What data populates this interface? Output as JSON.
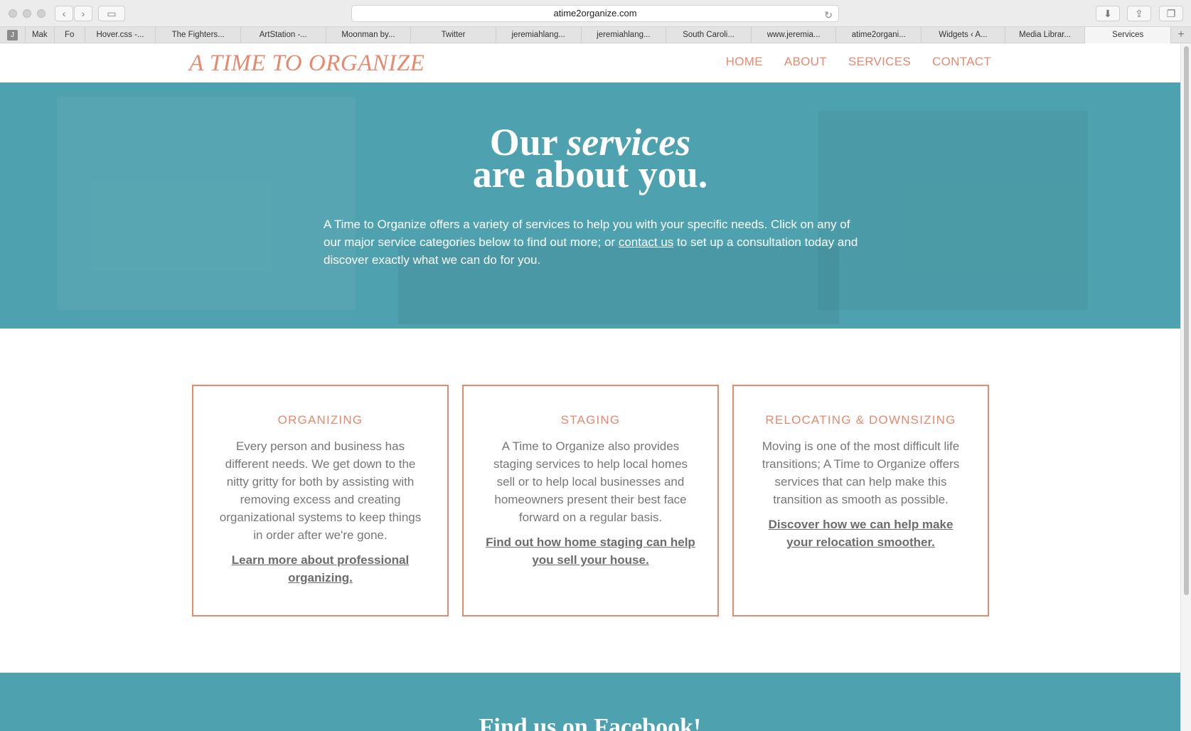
{
  "browser": {
    "url": "atime2organize.com",
    "favicon_letter": "J",
    "tabs": [
      "Mak",
      "Fo",
      "Hover.css -...",
      "The Fighters...",
      "ArtStation -...",
      "Moonman by...",
      "Twitter",
      "jeremiahlang...",
      "jeremiahlang...",
      "South Caroli...",
      "www.jeremia...",
      "atime2organi...",
      "Widgets ‹ A...",
      "Media Librar...",
      "Services"
    ],
    "active_tab": "Services"
  },
  "site": {
    "logo": "A TIME TO ORGANIZE",
    "nav": [
      "HOME",
      "ABOUT",
      "SERVICES",
      "CONTACT"
    ]
  },
  "hero": {
    "title_our": "Our",
    "title_services": "services",
    "title_line2": "are about you.",
    "intro_before": "A Time to Organize offers a variety of services to help you with your specific needs. Click on any of our major service categories below to find out more; or",
    "intro_link": "contact us",
    "intro_after": "to set up a consultation today and discover exactly what we can do for you."
  },
  "services": [
    {
      "title": "ORGANIZING",
      "text": "Every person and business has different needs. We get down to the nitty gritty for both by assisting with removing excess and creating organizational systems to keep things in order after we're gone.",
      "link": "Learn more about professional organizing."
    },
    {
      "title": "STAGING",
      "text": "A Time to Organize also provides staging services to help local homes sell or to help local businesses and homeowners present their best face forward on a regular basis.",
      "link": "Find out how home staging can help you sell your house."
    },
    {
      "title": "RELOCATING & DOWNSIZING",
      "text": "Moving is one of the most difficult life transitions; A Time to Organize offers services that can help make this transition as smooth as possible.",
      "link": "Discover how we can help make your relocation smoother."
    }
  ],
  "footer": {
    "title": "Find us on Facebook!"
  },
  "colors": {
    "accent": "#e7896f",
    "teal": "#4ea1ae"
  }
}
